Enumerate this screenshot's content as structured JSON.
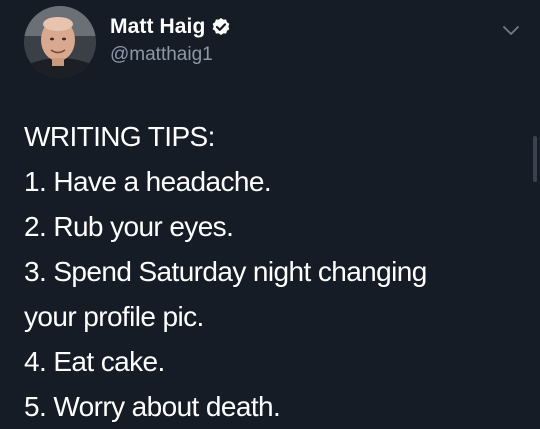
{
  "author": {
    "display_name": "Matt Haig",
    "handle": "@matthaig1",
    "verified": true
  },
  "icons": {
    "verified": "verified-badge-icon",
    "menu": "chevron-down-icon"
  },
  "tweet": {
    "lines": [
      "WRITING TIPS:",
      "1. Have a headache.",
      "2. Rub your eyes.",
      "3. Spend Saturday night changing",
      "your profile pic.",
      "4. Eat cake.",
      "5. Worry about death."
    ]
  },
  "colors": {
    "background": "#151c26",
    "text": "#ffffff",
    "secondary_text": "#8c98a8"
  }
}
